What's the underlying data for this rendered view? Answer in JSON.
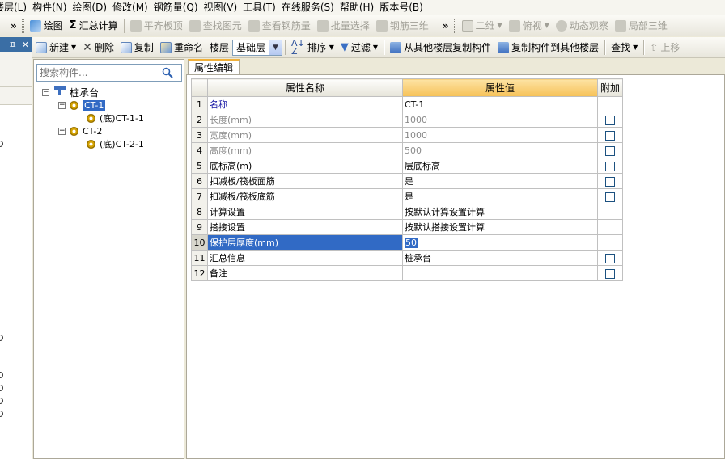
{
  "menu": [
    "楼层(L)",
    "构件(N)",
    "绘图(D)",
    "修改(M)",
    "钢筋量(Q)",
    "视图(V)",
    "工具(T)",
    "在线服务(S)",
    "帮助(H)",
    "版本号(B)"
  ],
  "toolbar1": {
    "draw": "绘图",
    "summary": "汇总计算",
    "flat_board": "平齐板顶",
    "find_element": "查找图元",
    "view_rebar": "查看钢筋量",
    "batch_select": "批量选择",
    "rebar_3d": "钢筋三维",
    "view_mode": "二维",
    "top_view": "俯视",
    "dynamic_view": "动态观察",
    "local_3d": "局部三维"
  },
  "toolbar2": {
    "new": "新建",
    "delete": "删除",
    "copy": "复制",
    "rename": "重命名",
    "floor_label": "楼层",
    "floor_value": "基础层",
    "sort": "排序",
    "filter": "过滤",
    "copy_from_floor": "从其他楼层复制构件",
    "copy_to_floor": "复制构件到其他楼层",
    "find": "查找",
    "move_up": "上移"
  },
  "tree": {
    "search_placeholder": "搜索构件...",
    "root": "桩承台",
    "nodes": [
      {
        "label": "CT-1",
        "child": "(底)CT-1-1"
      },
      {
        "label": "CT-2",
        "child": "(底)CT-2-1"
      }
    ]
  },
  "props": {
    "tab": "属性编辑",
    "headers": {
      "name": "属性名称",
      "value": "属性值",
      "extra": "附加"
    },
    "rows": [
      {
        "num": "1",
        "name": "名称",
        "value": "CT-1"
      },
      {
        "num": "2",
        "name": "长度(mm)",
        "value": "1000"
      },
      {
        "num": "3",
        "name": "宽度(mm)",
        "value": "1000"
      },
      {
        "num": "4",
        "name": "高度(mm)",
        "value": "500"
      },
      {
        "num": "5",
        "name": "底标高(m)",
        "value": "层底标高"
      },
      {
        "num": "6",
        "name": "扣减板/筏板面筋",
        "value": "是"
      },
      {
        "num": "7",
        "name": "扣减板/筏板底筋",
        "value": "是"
      },
      {
        "num": "8",
        "name": "计算设置",
        "value": "按默认计算设置计算"
      },
      {
        "num": "9",
        "name": "搭接设置",
        "value": "按默认搭接设置计算"
      },
      {
        "num": "10",
        "name": "保护层厚度(mm)",
        "value": "50"
      },
      {
        "num": "11",
        "name": "汇总信息",
        "value": "桩承台"
      },
      {
        "num": "12",
        "name": "备注",
        "value": ""
      }
    ]
  }
}
